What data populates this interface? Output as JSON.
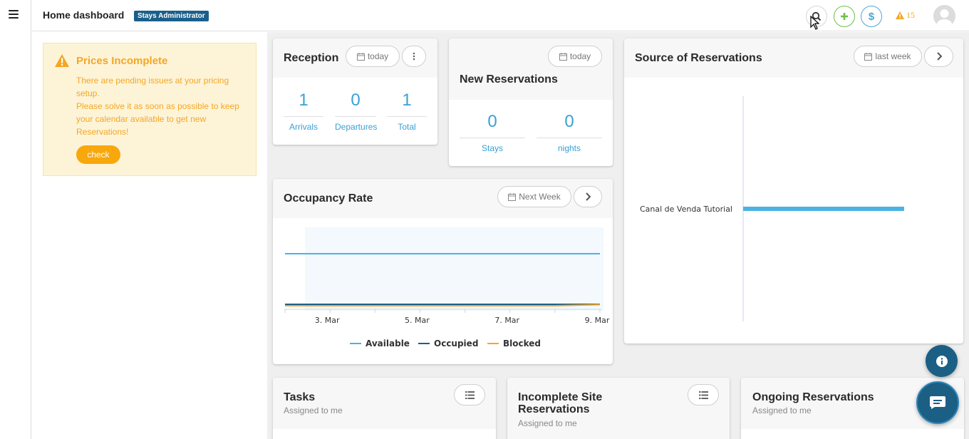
{
  "header": {
    "title": "Home dashboard",
    "role_badge": "Stays Administrator",
    "alert_count": "15"
  },
  "icons": {
    "menu": "hamburger-icon",
    "search": "search-icon",
    "add": "plus-icon",
    "money": "dollar-icon",
    "alert": "warning-icon",
    "avatar": "user-avatar",
    "calendar": "calendar-icon",
    "more": "more-vertical-icon",
    "next": "chevron-right-icon",
    "list": "list-icon",
    "info": "info-icon",
    "chat": "chat-icon"
  },
  "colors": {
    "accent_blue": "#3aa0d4",
    "warning": "#f5a623",
    "badge": "#1a5f8a",
    "available": "#4ab3e2",
    "occupied": "#1b5f8f",
    "blocked": "#f5a623"
  },
  "warning": {
    "title": "Prices Incomplete",
    "line1": "There are pending issues at your pricing setup.",
    "line2": "Please solve it as soon as possible to keep your calendar available to get new Reservations!",
    "check_label": "check"
  },
  "reception": {
    "title": "Reception",
    "range_label": "today",
    "stats": [
      {
        "value": "1",
        "label": "Arrivals"
      },
      {
        "value": "0",
        "label": "Departures"
      },
      {
        "value": "1",
        "label": "Total"
      }
    ]
  },
  "new_reservations": {
    "title": "New Reservations",
    "range_label": "today",
    "stats": [
      {
        "value": "0",
        "label": "Stays"
      },
      {
        "value": "0",
        "label": "nights"
      }
    ]
  },
  "occupancy": {
    "title": "Occupancy Rate",
    "range_label": "Next Week",
    "x_ticks": [
      "3. Mar",
      "5. Mar",
      "7. Mar",
      "9. Mar"
    ],
    "legend": [
      "Available",
      "Occupied",
      "Blocked"
    ]
  },
  "source": {
    "title": "Source of Reservations",
    "range_label": "last week",
    "category": "Canal de Venda Tutorial"
  },
  "tasks": {
    "title": "Tasks",
    "subtitle": "Assigned to me"
  },
  "incomplete": {
    "title_line1": "Incomplete Site",
    "title_line2": "Reservations",
    "subtitle": "Assigned to me"
  },
  "ongoing": {
    "title": "Ongoing Reservations",
    "subtitle": "Assigned to me"
  },
  "chart_data": [
    {
      "type": "line",
      "x": [
        "2. Mar",
        "3. Mar",
        "4. Mar",
        "5. Mar",
        "6. Mar",
        "7. Mar",
        "8. Mar",
        "9. Mar"
      ],
      "series": [
        {
          "name": "Available",
          "values": [
            1,
            1,
            1,
            1,
            1,
            1,
            1,
            1
          ]
        },
        {
          "name": "Occupied",
          "values": [
            0,
            0,
            0,
            0,
            0,
            0,
            0,
            0
          ]
        },
        {
          "name": "Blocked",
          "values": [
            0,
            0,
            0,
            0,
            0,
            0,
            0,
            0.02
          ]
        }
      ],
      "title": "Occupancy Rate",
      "xlabel": "",
      "ylabel": "",
      "ylim": [
        0,
        1.3
      ]
    },
    {
      "type": "bar",
      "orientation": "horizontal",
      "categories": [
        "Canal de Venda Tutorial"
      ],
      "values": [
        1
      ],
      "title": "Source of Reservations",
      "xlabel": "",
      "ylabel": ""
    }
  ]
}
